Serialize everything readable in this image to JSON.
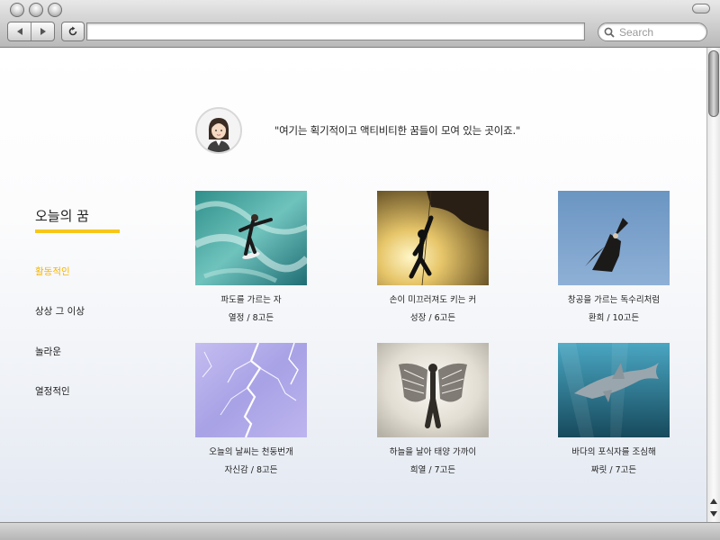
{
  "browser": {
    "search": {
      "placeholder": "Search",
      "value": ""
    },
    "address": {
      "value": ""
    },
    "icons": [
      "back-arrow-icon",
      "forward-arrow-icon",
      "reload-icon",
      "search-icon"
    ]
  },
  "hero": {
    "quote": "\"여기는 획기적이고 액티비티한 꿈들이 모여 있는 곳이죠.\"",
    "avatar_icon": "female-avatar-icon"
  },
  "sidebar": {
    "title": "오늘의 꿈",
    "accent_color": "#f7c61b",
    "items": [
      {
        "label": "활동적인",
        "active": true
      },
      {
        "label": "상상 그 이상",
        "active": false
      },
      {
        "label": "놀라운",
        "active": false
      },
      {
        "label": "열정적인",
        "active": false
      }
    ]
  },
  "cards": [
    {
      "title": "파도를 가르는 자",
      "meta": "열정 / 8고든",
      "image": "surfer-wave"
    },
    {
      "title": "손이 미끄러져도 키는 커",
      "meta": "성장 / 6고든",
      "image": "rock-climber-sunset"
    },
    {
      "title": "창공을 가르는 독수리처럼",
      "meta": "환희 / 10고든",
      "image": "eagle-blue-sky"
    },
    {
      "title": "오늘의 날씨는 천둥번개",
      "meta": "자신감 / 8고든",
      "image": "lightning-purple-sky"
    },
    {
      "title": "하늘을 날아 태양 가까이",
      "meta": "희열 / 7고든",
      "image": "winged-man"
    },
    {
      "title": "바다의 포식자를 조심해",
      "meta": "짜릿 / 7고든",
      "image": "shark-underwater"
    }
  ]
}
